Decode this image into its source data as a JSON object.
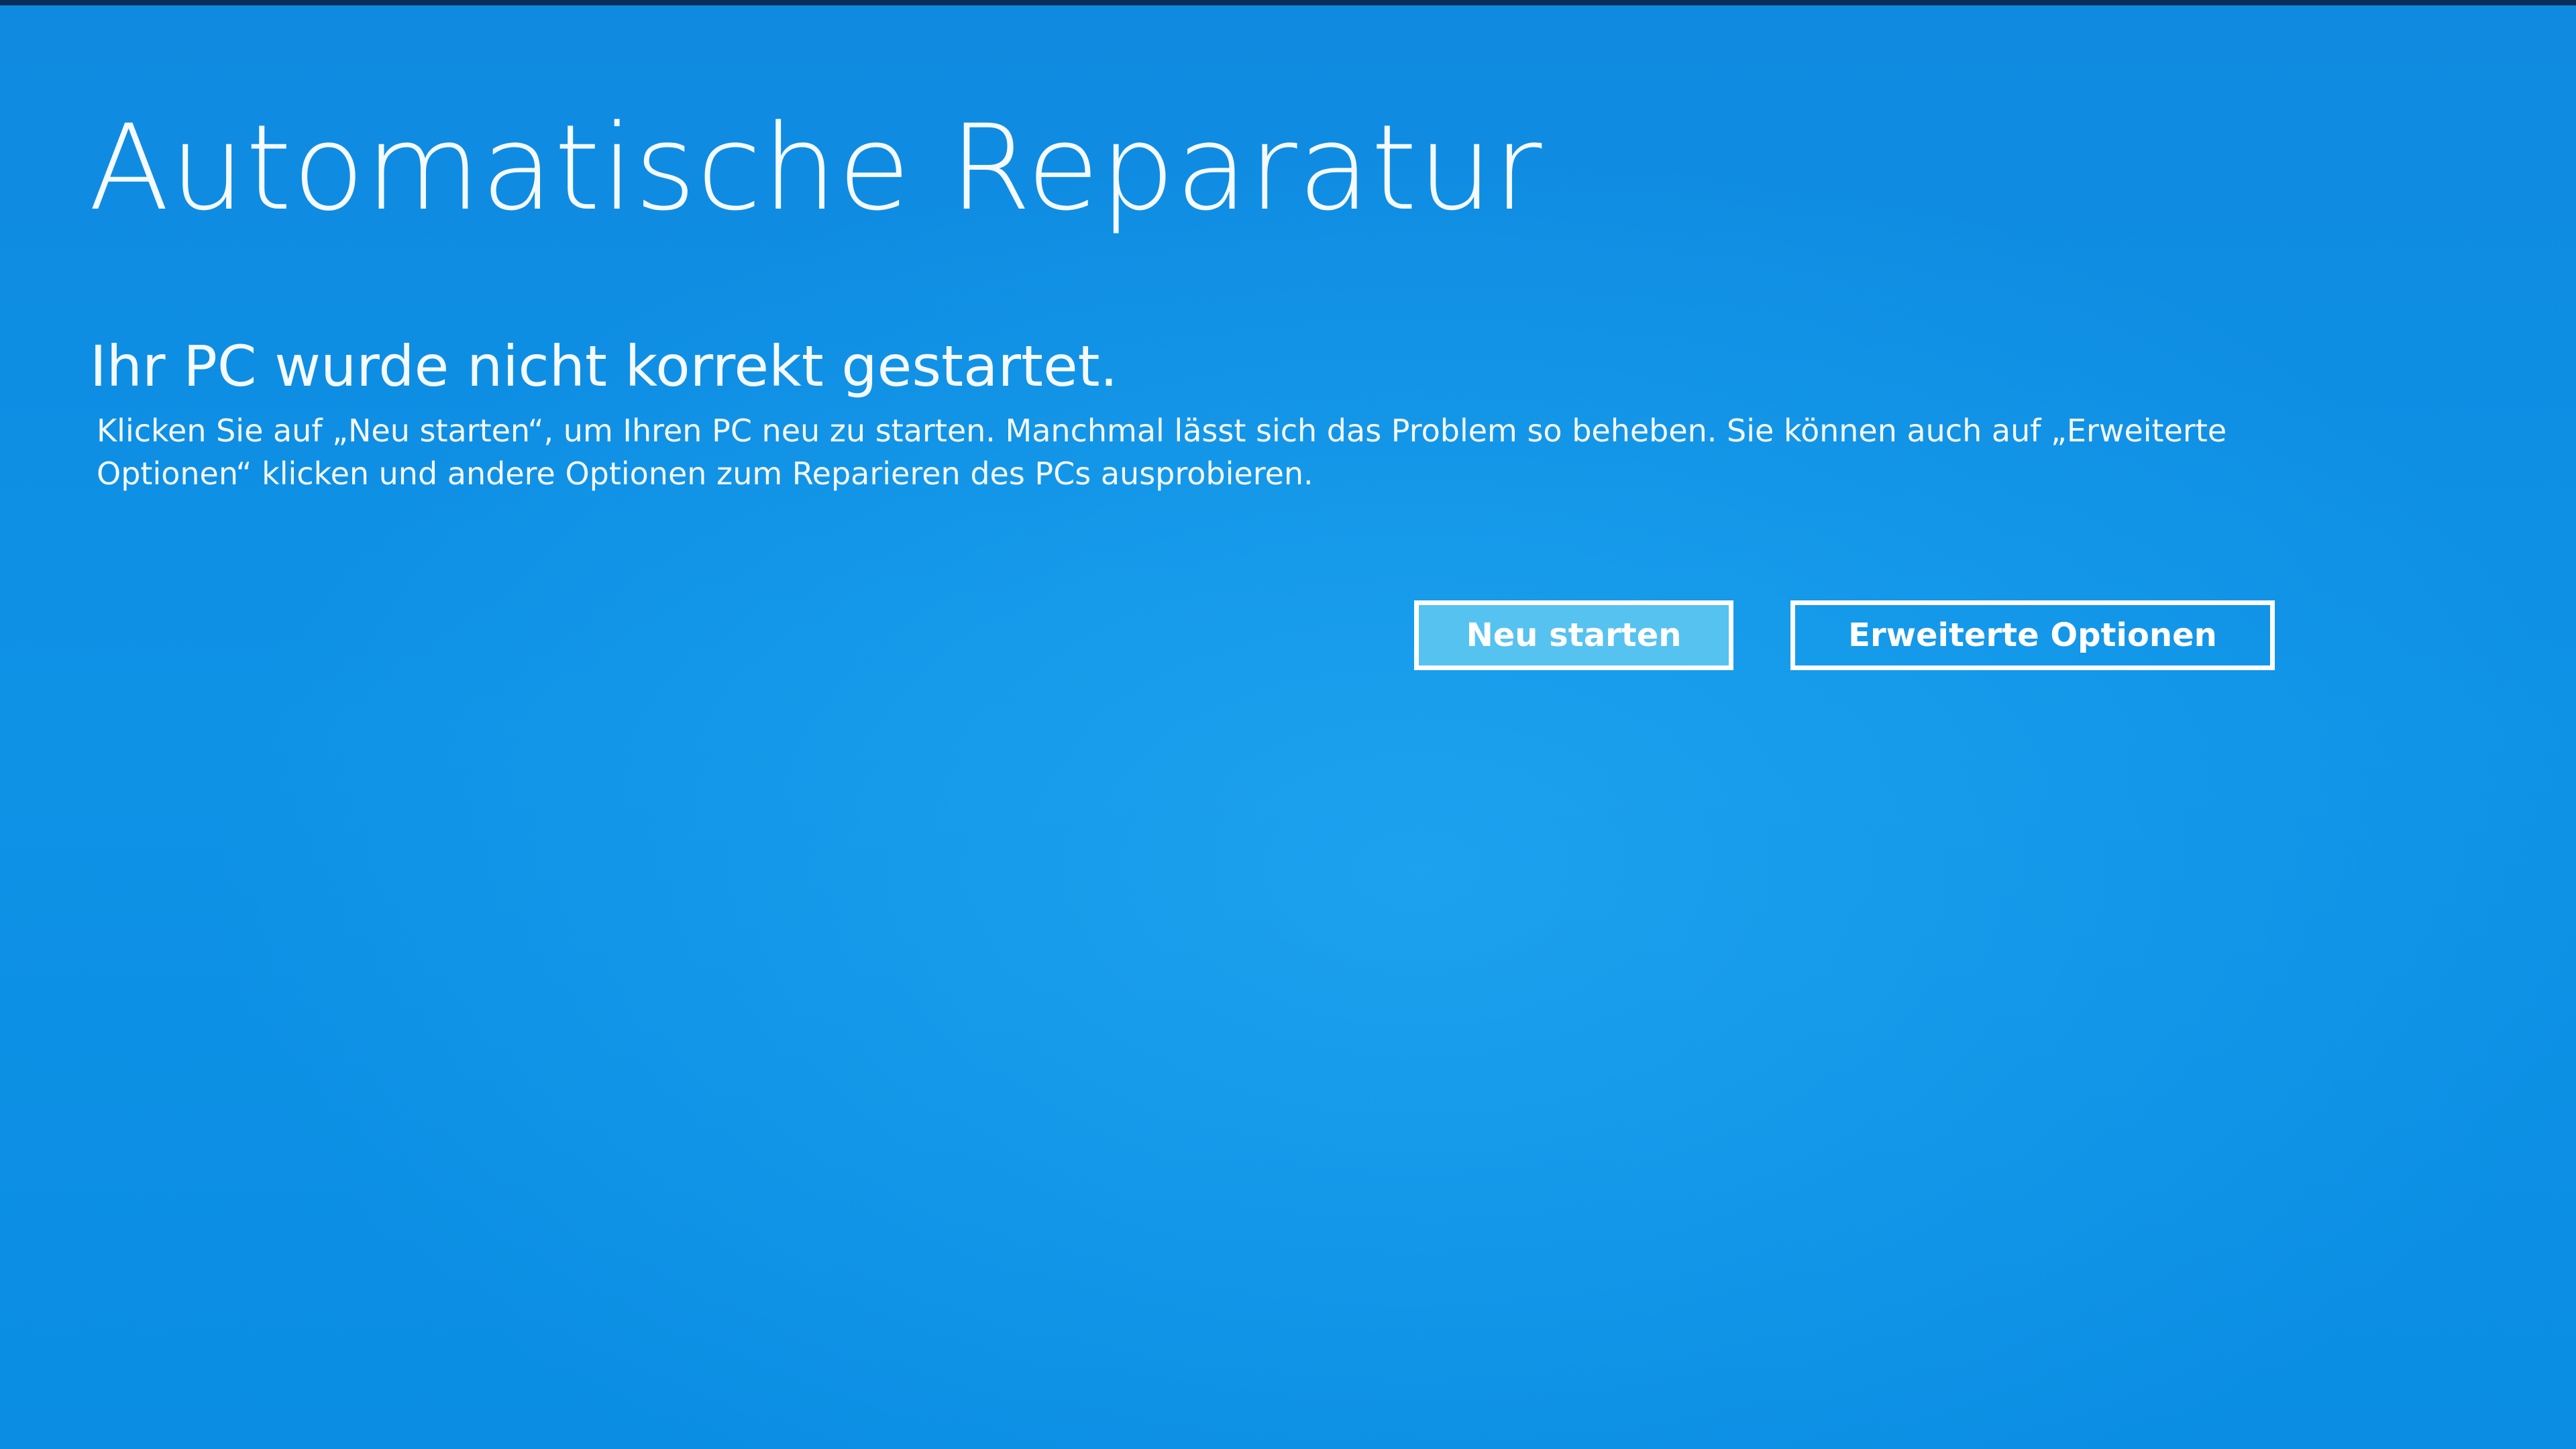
{
  "screen": {
    "title": "Automatische Reparatur",
    "subtitle": "Ihr PC wurde nicht korrekt gestartet.",
    "description": "Klicken Sie auf „Neu starten“, um Ihren PC neu zu starten. Manchmal lässt sich das Problem so beheben. Sie können auch auf „Erweiterte Optionen“ klicken und andere Optionen zum Reparieren des PCs ausprobieren."
  },
  "buttons": {
    "restart_label": "Neu starten",
    "advanced_label": "Erweiterte Optionen"
  },
  "colors": {
    "background": "#0f8fe2",
    "text": "#ffffff",
    "focused_button_fill": "#56c2f0"
  }
}
